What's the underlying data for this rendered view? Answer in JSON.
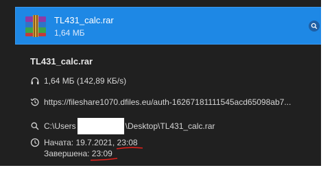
{
  "download": {
    "file_name": "TL431_calc.rar",
    "size_short": "1,64 МБ",
    "size_detail": "1,64 МБ (142,89 КБ/s)",
    "url": "https://fileshare1070.dfiles.eu/auth-16267181111545acd65098ab7...",
    "path_prefix": "C:\\Users",
    "path_suffix": "\\Desktop\\TL431_calc.rar",
    "started_label": "Начата:",
    "started_date": "19.7.2021,",
    "started_time": "23:08",
    "finished_label": "Завершена:",
    "finished_time": "23:09"
  },
  "icons": {
    "file": "winrar-archive-icon",
    "search": "search-icon",
    "size": "headphones-icon",
    "url": "history-icon",
    "path": "search-icon",
    "time": "clock-icon"
  },
  "colors": {
    "accent": "#1e88e5",
    "panel": "#202020",
    "text": "#d6d6d6",
    "annotation": "#e0201b"
  }
}
